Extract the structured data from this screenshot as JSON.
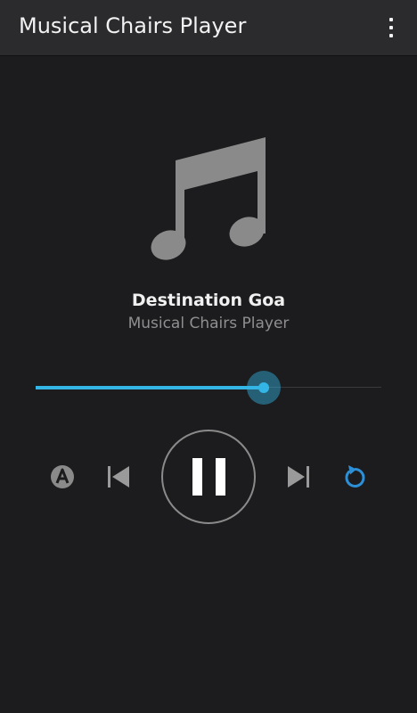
{
  "app": {
    "title": "Musical Chairs Player"
  },
  "now_playing": {
    "title": "Destination Goa",
    "artist": "Musical Chairs Player",
    "progress": 0.66
  },
  "controls": {
    "auto_icon": "auto-a-icon",
    "previous_icon": "skip-previous-icon",
    "play_pause_icon": "pause-icon",
    "next_icon": "skip-next-icon",
    "repeat_icon": "repeat-icon"
  },
  "colors": {
    "accent": "#33b5e5",
    "repeat_active": "#2d8fd6",
    "background": "#1c1b1d",
    "action_bar": "#2b2b2d"
  }
}
